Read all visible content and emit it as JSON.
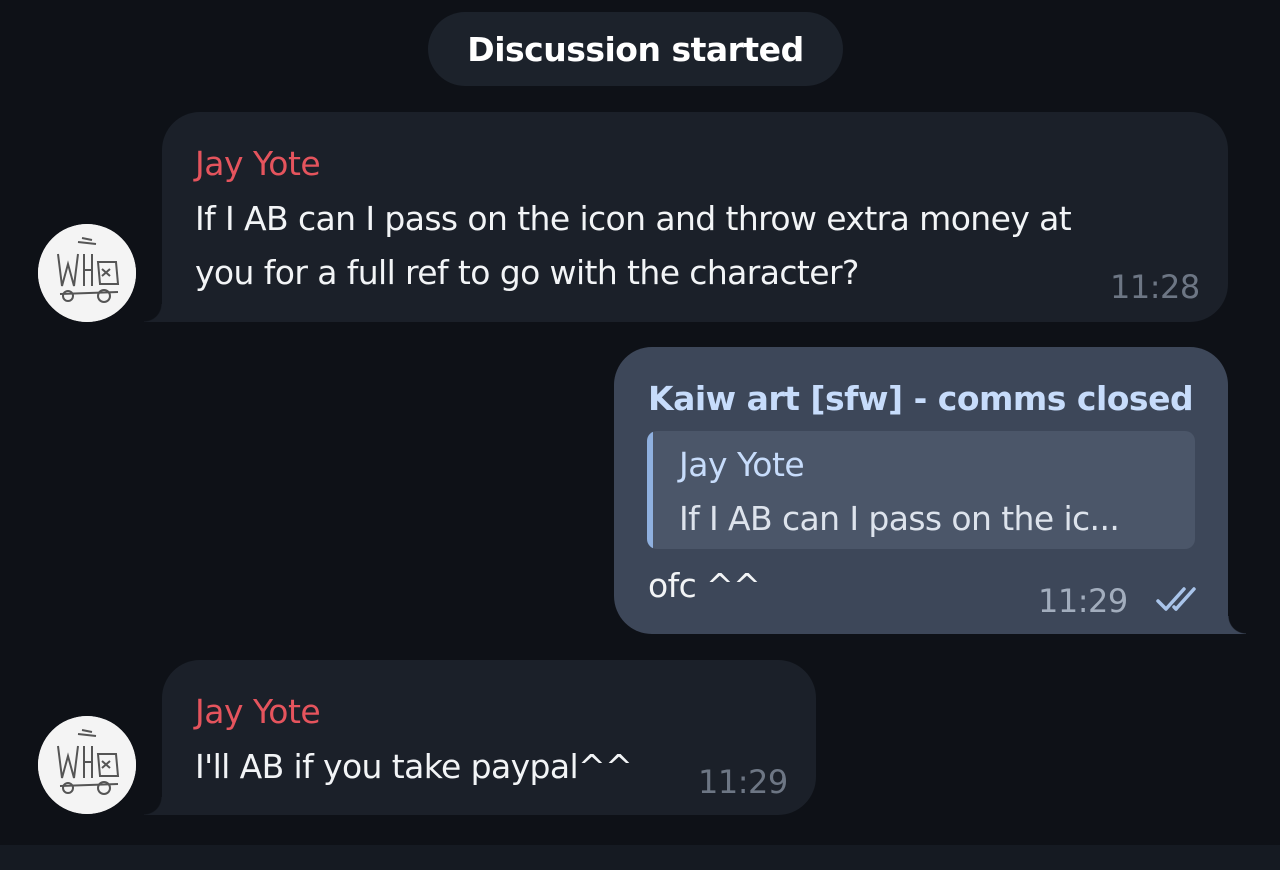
{
  "service": {
    "discussion_started": "Discussion started"
  },
  "messages": [
    {
      "sender": "Jay Yote",
      "text_line1": "If I AB can I pass on the icon and throw extra money at",
      "text_line2": "you for a full ref to go with the character?",
      "time": "11:28"
    },
    {
      "sender": "Kaiw art [sfw] - comms closed",
      "reply_name": "Jay Yote",
      "reply_text": "If I AB can I pass on the ic...",
      "text": "ofc ^^",
      "time": "11:29",
      "status_icon": "double-check-icon"
    },
    {
      "sender": "Jay Yote",
      "text": "I'll AB if you take paypal^^",
      "time": "11:29"
    }
  ],
  "colors": {
    "background": "#0e1117",
    "incoming_bubble": "#1b2029",
    "outgoing_bubble": "#3d4759",
    "incoming_sender": "#e5545d",
    "outgoing_sender": "#c7dcfb",
    "reply_accent": "#8fb0df"
  }
}
